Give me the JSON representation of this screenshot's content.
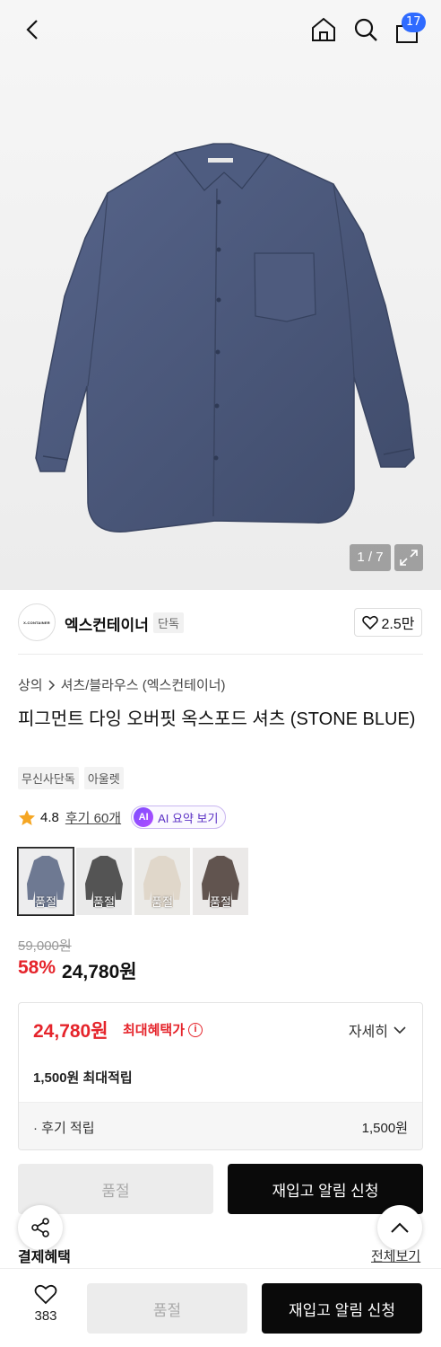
{
  "header": {
    "cart_count": "17"
  },
  "gallery": {
    "counter": "1 / 7"
  },
  "brand": {
    "logo_text": "X-CONTAINER",
    "name": "엑스컨테이너",
    "tag": "단독",
    "likes": "2.5만"
  },
  "breadcrumb": {
    "category": "상의",
    "subcategory": "셔츠/블라우스 (엑스컨테이너)"
  },
  "product": {
    "title": "피그먼트 다잉 오버핏 옥스포드 셔츠 (STONE BLUE)",
    "chips": [
      "무신사단독",
      "아울렛"
    ],
    "rating": "4.8",
    "reviews": "후기 60개",
    "ai_button": "AI 요약 보기",
    "ai_badge": "AI"
  },
  "colors": [
    {
      "label": "품절",
      "color": "#4a5877"
    },
    {
      "label": "품절",
      "color": "#2a2a2a"
    },
    {
      "label": "품절",
      "color": "#d9cdbd"
    },
    {
      "label": "품절",
      "color": "#3a2a24"
    }
  ],
  "price": {
    "original": "59,000원",
    "discount_rate": "58%",
    "sale": "24,780원"
  },
  "benefit": {
    "max_price": "24,780원",
    "max_label": "최대혜택가",
    "detail_button": "자세히",
    "points": "1,500원 최대적립",
    "review_points_label": "· 후기 적립",
    "review_points_value": "1,500원"
  },
  "actions": {
    "soldout": "품절",
    "restock": "재입고 알림 신청"
  },
  "pay_benefit": {
    "title": "결제혜택",
    "see_all": "전체보기"
  },
  "bottom_bar": {
    "like_count": "383",
    "soldout": "품절",
    "restock": "재입고 알림 신청"
  }
}
